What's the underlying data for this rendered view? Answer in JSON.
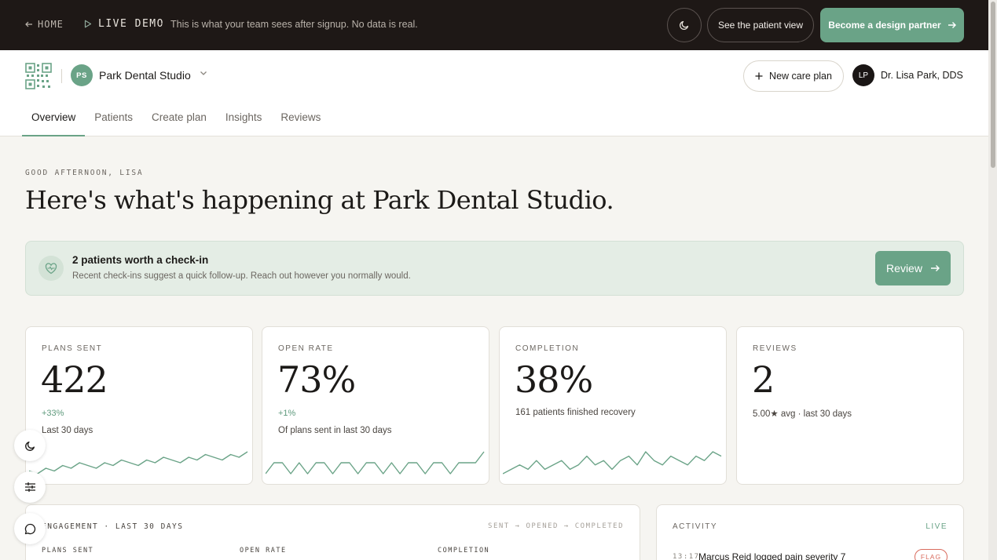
{
  "demo_bar": {
    "home_label": "HOME",
    "live_label": "LIVE DEMO",
    "separator": "·",
    "note": "This is what your team sees after signup. No data is real.",
    "patient_view_label": "See the patient view",
    "partner_label": "Become a design partner"
  },
  "header": {
    "workspace_initials": "PS",
    "workspace_name": "Park Dental Studio",
    "new_plan_label": "New care plan",
    "user_initials": "LP",
    "user_name": "Dr. Lisa Park, DDS"
  },
  "tabs": [
    {
      "label": "Overview",
      "active": true
    },
    {
      "label": "Patients",
      "active": false
    },
    {
      "label": "Create plan",
      "active": false
    },
    {
      "label": "Insights",
      "active": false
    },
    {
      "label": "Reviews",
      "active": false
    }
  ],
  "greeting": {
    "kicker": "GOOD AFTERNOON, LISA",
    "title": "Here's what's happening at Park Dental Studio."
  },
  "banner": {
    "title": "2 patients worth a check-in",
    "subtitle": "Recent check-ins suggest a quick follow-up. Reach out however you normally would.",
    "button_label": "Review"
  },
  "metrics": [
    {
      "label": "PLANS SENT",
      "value": "422",
      "delta": "+33%",
      "sub": "Last 30 days",
      "spark": [
        3,
        2,
        4,
        3,
        5,
        4,
        6,
        5,
        4,
        6,
        5,
        7,
        6,
        5,
        7,
        6,
        8,
        7,
        6,
        8,
        7,
        9,
        8,
        7,
        9,
        8,
        10
      ]
    },
    {
      "label": "OPEN RATE",
      "value": "73%",
      "delta": "+1%",
      "sub": "Of plans sent in last 30 days",
      "spark": [
        6,
        7,
        7,
        6,
        7,
        6,
        7,
        7,
        6,
        7,
        7,
        6,
        7,
        7,
        6,
        7,
        6,
        7,
        7,
        6,
        7,
        7,
        6,
        7,
        7,
        7,
        8
      ]
    },
    {
      "label": "COMPLETION",
      "value": "38%",
      "delta": "",
      "sub": "161 patients finished recovery",
      "spark": [
        2,
        3,
        4,
        3,
        5,
        3,
        4,
        5,
        3,
        4,
        6,
        4,
        5,
        3,
        5,
        6,
        4,
        7,
        5,
        4,
        6,
        5,
        4,
        6,
        5,
        7,
        6
      ]
    },
    {
      "label": "REVIEWS",
      "value": "2",
      "delta": "",
      "sub": "5.00★ avg · last 30 days",
      "spark": []
    }
  ],
  "engagement": {
    "title": "ENGAGEMENT · LAST 30 DAYS",
    "legend": "SENT → OPENED → COMPLETED",
    "columns": [
      "PLANS SENT",
      "OPEN RATE",
      "COMPLETION"
    ]
  },
  "activity": {
    "title": "ACTIVITY",
    "live_label": "LIVE",
    "items": [
      {
        "time": "13:17",
        "text": "Marcus Reid logged pain severity 7",
        "tag": "FLAG"
      }
    ]
  },
  "colors": {
    "accent": "#6aa387",
    "dark_bar": "#1e1816",
    "flag": "#d96c5e"
  },
  "icons": {
    "back": "arrow-left-icon",
    "live": "play-icon",
    "theme": "moon-icon",
    "partner_arrow": "arrow-right-icon",
    "logo": "qr-logo-icon",
    "new_plan": "plus-icon",
    "banner": "heart-pulse-icon",
    "settings": "sliders-icon",
    "chat": "chat-bubble-icon"
  }
}
